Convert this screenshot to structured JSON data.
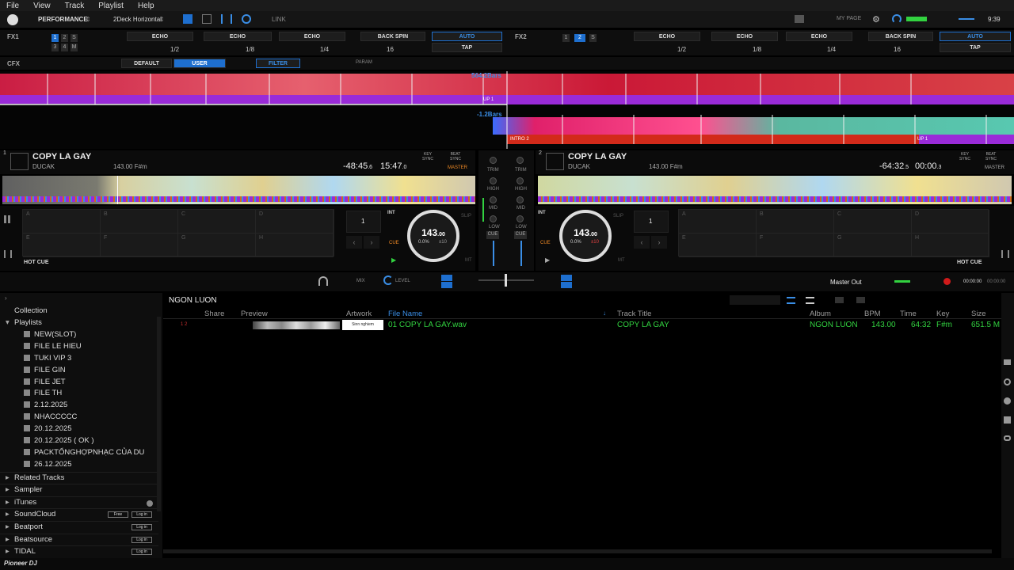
{
  "menu": [
    "File",
    "View",
    "Track",
    "Playlist",
    "Help"
  ],
  "topbar": {
    "mode": "PERFORMANCE",
    "layout": "2Deck Horizontal",
    "link": "LINK",
    "my_page": "MY PAGE",
    "clock": "9:39"
  },
  "fx1": {
    "label": "FX1",
    "effects": [
      "ECHO",
      "ECHO",
      "ECHO"
    ],
    "beats": [
      "1/2",
      "1/8",
      "1/4"
    ],
    "backspin": "BACK SPIN",
    "backspin_val": "16",
    "auto": "AUTO",
    "tap": "TAP"
  },
  "fx2": {
    "label": "FX2",
    "effects": [
      "ECHO",
      "ECHO",
      "ECHO"
    ],
    "beats": [
      "1/2",
      "1/8",
      "1/4"
    ],
    "backspin": "BACK SPIN",
    "backspin_val": "16",
    "auto": "AUTO",
    "tap": "TAP"
  },
  "cfx": {
    "label": "CFX",
    "default": "DEFAULT",
    "user": "USER",
    "filter": "FILTER",
    "param": "PARAM"
  },
  "overview": {
    "bars_top": "564.2Bars",
    "bars_bottom": "-1.2Bars",
    "cue_up1": "UP 1",
    "cue_intro2": "INTRO 2",
    "cue_up1b": "UP 1"
  },
  "deck1": {
    "num": "1",
    "title": "COPY LA GAY",
    "artist": "DUCAK",
    "bpm_key": "143.00 F#m",
    "remain": "-48:45",
    "remain_frac": ".6",
    "elapsed": "15:47",
    "elapsed_frac": ".0",
    "bpm_big": "143",
    "bpm_dec": ".00",
    "pitch": "0.0%",
    "range": "±10",
    "hotcue": "HOT CUE",
    "loop_val": "1",
    "int": "INT",
    "slip": "SLIP",
    "cue": "CUE",
    "mt": "MT",
    "master": "MASTER",
    "key_sync": "KEY SYNC",
    "beat_sync": "BEAT SYNC",
    "pads": [
      "A",
      "B",
      "C",
      "D",
      "E",
      "F",
      "G",
      "H"
    ]
  },
  "deck2": {
    "num": "2",
    "title": "COPY LA GAY",
    "artist": "DUCAK",
    "bpm_key": "143.00 F#m",
    "remain": "-64:32",
    "remain_frac": ".5",
    "elapsed": "00:00",
    "elapsed_frac": ".3",
    "bpm_big": "143",
    "bpm_dec": ".00",
    "pitch": "0.0%",
    "range": "±10",
    "hotcue": "HOT CUE",
    "loop_val": "1",
    "int": "INT",
    "slip": "SLIP",
    "cue": "CUE",
    "mt": "MT",
    "master": "MASTER",
    "key_sync": "KEY SYNC",
    "beat_sync": "BEAT SYNC",
    "pads": [
      "A",
      "B",
      "C",
      "D",
      "E",
      "F",
      "G",
      "H"
    ]
  },
  "mixer": {
    "trim": "TRIM",
    "high": "HIGH",
    "mid": "MID",
    "low": "LOW",
    "cue": "CUE",
    "mix": "MIX",
    "level": "LEVEL",
    "master_out": "Master Out",
    "time1": "00:00:00",
    "time2": "00:00:00"
  },
  "browser": {
    "playlist_name": "NGON LUON",
    "tree": {
      "collection": "Collection",
      "playlists": "Playlists",
      "items": [
        "NEW(SLOT)",
        "FILE LE HIEU",
        "TUKI VIP 3",
        "FILE GIN",
        "FILE JET",
        "FILE TH",
        "2.12.2025",
        "NHACCCCC",
        "20.12.2025",
        "20.12.2025 ( OK )",
        "PACKTỔNGHỢPNHẠC CỦA DU",
        "26.12.2025"
      ],
      "related": "Related Tracks",
      "sampler": "Sampler",
      "itunes": "iTunes",
      "soundcloud": "SoundCloud",
      "beatport": "Beatport",
      "beatsource": "Beatsource",
      "tidal": "TIDAL",
      "free": "Free",
      "login": "Log in"
    },
    "columns": [
      "Share",
      "Preview",
      "Artwork",
      "File Name",
      "Track Title",
      "Album",
      "BPM",
      "Time",
      "Key",
      "Size"
    ],
    "rows": [
      {
        "deck_marker": "1 2",
        "artwork_hint": "Sinn nghiem",
        "file": "01 COPY LA GAY.wav",
        "title": "COPY LA GAY",
        "album": "NGON LUON",
        "bpm": "143.00",
        "time": "64:32",
        "key": "F#m",
        "size": "651.5 M"
      }
    ]
  },
  "footer": {
    "logo": "Pioneer DJ"
  },
  "colors": {
    "accent": "#1e6fcf",
    "green": "#32d240",
    "master_orange": "#f08a24"
  }
}
